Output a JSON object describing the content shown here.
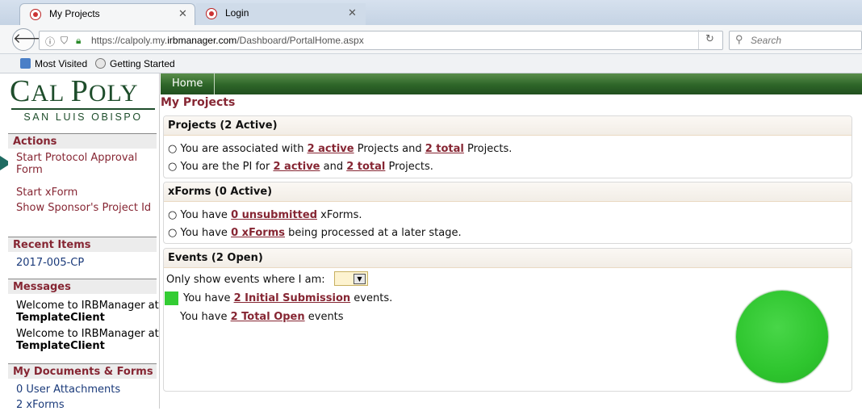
{
  "browser": {
    "tabs": [
      {
        "label": "My Projects",
        "active": true
      },
      {
        "label": "Login",
        "active": false
      }
    ],
    "url_prefix": "https://calpoly.my.",
    "url_domain": "irbmanager.com",
    "url_path": "/Dashboard/PortalHome.aspx",
    "search_placeholder": "Search",
    "bookmarks": [
      "Most Visited",
      "Getting Started"
    ]
  },
  "logo": {
    "line1": "Cal Poly",
    "line2": "SAN LUIS OBISPO"
  },
  "sidebar": {
    "actions_title": "Actions",
    "actions": [
      "Start Protocol Approval Form",
      "Start xForm",
      "Show Sponsor's Project Id"
    ],
    "recent_title": "Recent Items",
    "recent": [
      "2017-005-CP"
    ],
    "messages_title": "Messages",
    "messages": [
      {
        "prefix": "Welcome to IRBManager at ",
        "name": "TemplateClient"
      },
      {
        "prefix": "Welcome to IRBManager at ",
        "name": "TemplateClient"
      }
    ],
    "docs_title": "My Documents & Forms",
    "docs": [
      "0 User Attachments",
      "2 xForms"
    ]
  },
  "nav": {
    "home": "Home"
  },
  "page_title": "My Projects",
  "projects": {
    "title": "Projects (2 Active)",
    "line1": {
      "a": "You are associated with ",
      "l1": "2 active",
      "b": " Projects and ",
      "l2": "2 total",
      "c": " Projects."
    },
    "line2": {
      "a": "You are the PI for ",
      "l1": "2 active",
      "b": " and ",
      "l2": "2 total",
      "c": " Projects."
    }
  },
  "xforms": {
    "title": "xForms (0 Active)",
    "line1": {
      "a": "You have ",
      "l1": "0 unsubmitted",
      "b": " xForms."
    },
    "line2": {
      "a": "You have ",
      "l1": "0 xForms",
      "b": " being processed at a later stage."
    }
  },
  "events": {
    "title": "Events (2 Open)",
    "filter_label": "Only show events where I am:",
    "line1": {
      "a": "You have ",
      "l1": "2 Initial Submission",
      "b": " events."
    },
    "line2": {
      "a": "You have ",
      "l1": "2 Total Open",
      "b": " events"
    }
  },
  "colors": {
    "brand_green": "#1e4d2b",
    "link_maroon": "#862633",
    "status_green": "#33cc33"
  }
}
